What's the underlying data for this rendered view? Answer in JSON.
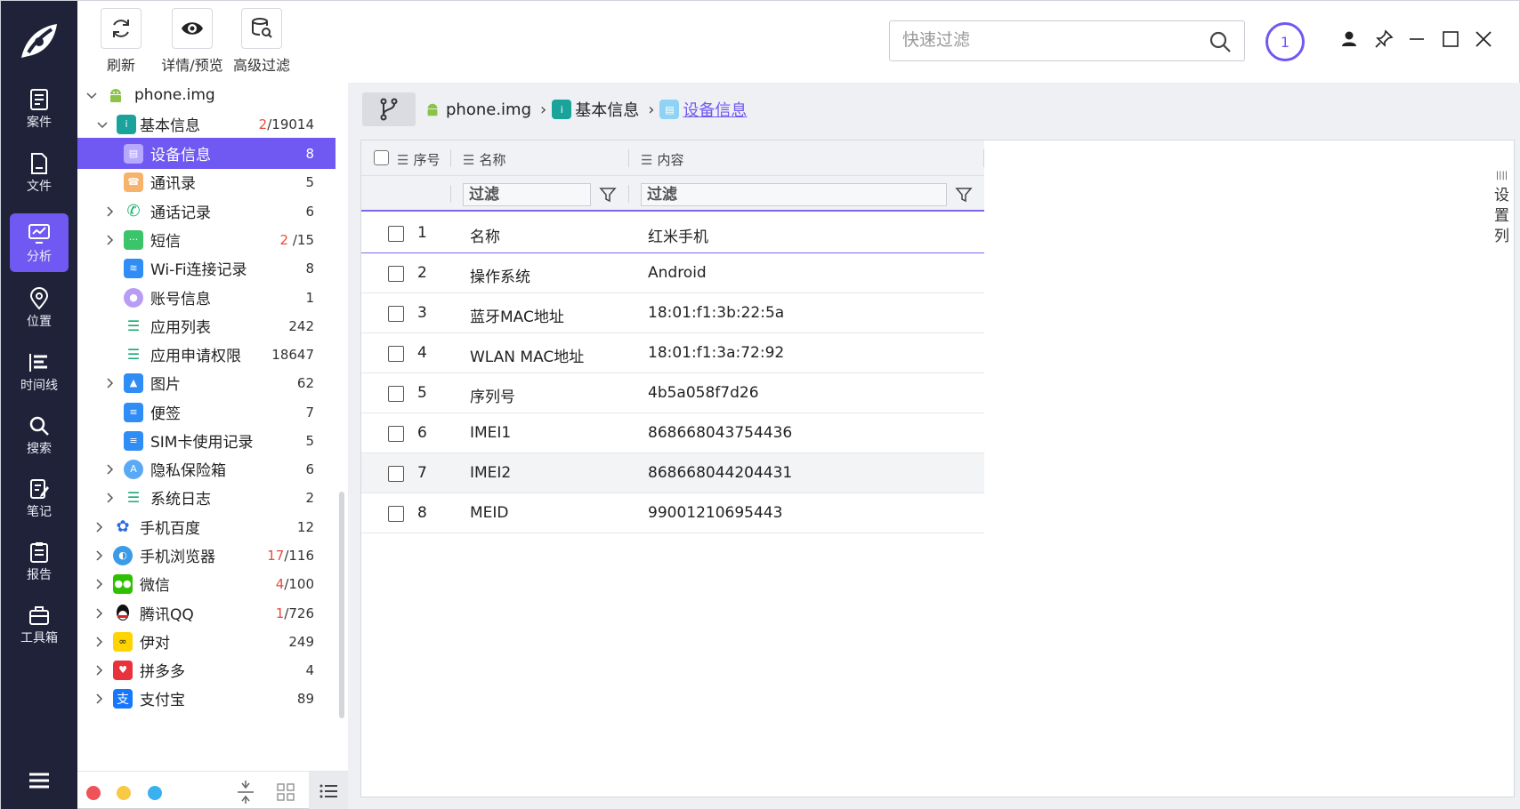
{
  "toolbar": {
    "refresh": "刷新",
    "preview": "详情/预览",
    "advanced_filter": "高级过滤"
  },
  "nav": {
    "items": [
      {
        "label": "案件"
      },
      {
        "label": "文件"
      },
      {
        "label": "分析"
      },
      {
        "label": "位置"
      },
      {
        "label": "时间线"
      },
      {
        "label": "搜索"
      },
      {
        "label": "笔记"
      },
      {
        "label": "报告"
      },
      {
        "label": "工具箱"
      }
    ]
  },
  "tree": {
    "root": "phone.img",
    "basic": {
      "label": "基本信息",
      "hl": "2",
      "rest": "/19014"
    },
    "items": [
      {
        "label": "设备信息",
        "count": "8"
      },
      {
        "label": "通讯录",
        "count": "5"
      },
      {
        "label": "通话记录",
        "count": "6"
      },
      {
        "label": "短信",
        "hl": "2",
        "rest": " /15"
      },
      {
        "label": "Wi-Fi连接记录",
        "count": "8"
      },
      {
        "label": "账号信息",
        "count": "1"
      },
      {
        "label": "应用列表",
        "count": "242"
      },
      {
        "label": "应用申请权限",
        "count": "18647"
      },
      {
        "label": "图片",
        "count": "62"
      },
      {
        "label": "便签",
        "count": "7"
      },
      {
        "label": "SIM卡使用记录",
        "count": "5"
      },
      {
        "label": "隐私保险箱",
        "count": "6"
      },
      {
        "label": "系统日志",
        "count": "2"
      }
    ],
    "apps": [
      {
        "label": "手机百度",
        "count": "12"
      },
      {
        "label": "手机浏览器",
        "hl": "17",
        "rest": "/116"
      },
      {
        "label": "微信",
        "hl": "4",
        "rest": "/100"
      },
      {
        "label": "腾讯QQ",
        "hl": "1",
        "rest": "/726"
      },
      {
        "label": "伊对",
        "count": "249"
      },
      {
        "label": "拼多多",
        "count": "4"
      },
      {
        "label": "支付宝",
        "count": "89"
      }
    ]
  },
  "search": {
    "placeholder": "快速过滤"
  },
  "badge": "1",
  "breadcrumb": {
    "root": "phone.img",
    "basic": "基本信息",
    "current": "设备信息",
    "sep": "›"
  },
  "grid": {
    "headers": {
      "seq": "序号",
      "name": "名称",
      "content": "内容"
    },
    "filter_placeholder": "过滤",
    "rows": [
      {
        "seq": "1",
        "name": "名称",
        "value": "红米手机"
      },
      {
        "seq": "2",
        "name": "操作系统",
        "value": "Android"
      },
      {
        "seq": "3",
        "name": "蓝牙MAC地址",
        "value": "18:01:f1:3b:22:5a"
      },
      {
        "seq": "4",
        "name": "WLAN MAC地址",
        "value": "18:01:f1:3a:72:92"
      },
      {
        "seq": "5",
        "name": "序列号",
        "value": "4b5a058f7d26"
      },
      {
        "seq": "6",
        "name": "IMEI1",
        "value": "868668043754436"
      },
      {
        "seq": "7",
        "name": "IMEI2",
        "value": "868668044204431"
      },
      {
        "seq": "8",
        "name": "MEID",
        "value": "99001210695443"
      }
    ]
  },
  "side_tab": {
    "c1": "设",
    "c2": "置",
    "c3": "列"
  },
  "colors": {
    "accent": "#6f59f2",
    "nav_bg": "#1f2238",
    "highlight_count": "#e74c3c"
  }
}
